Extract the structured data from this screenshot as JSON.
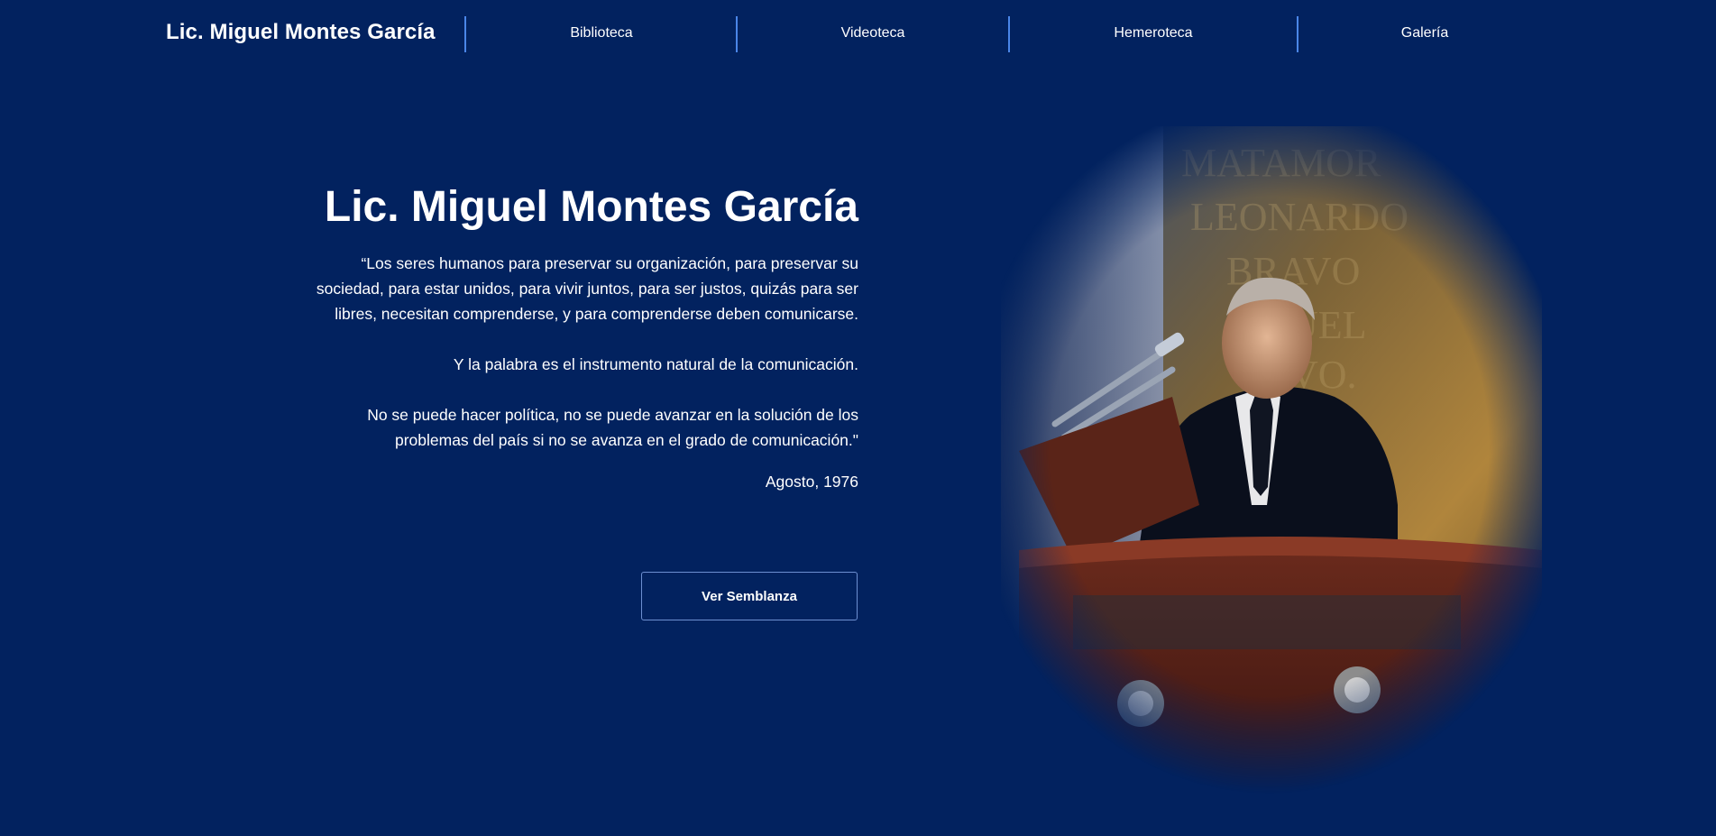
{
  "nav": {
    "brand": "Lic. Miguel Montes García",
    "links": [
      {
        "label": "Biblioteca"
      },
      {
        "label": "Videoteca"
      },
      {
        "label": "Hemeroteca"
      },
      {
        "label": "Galería"
      }
    ]
  },
  "hero": {
    "title": "Lic. Miguel Montes García",
    "quote": {
      "paragraph_1": "“Los seres humanos para preservar su organización, para preservar su sociedad, para estar unidos, para vivir juntos, para ser justos, quizás para ser libres, necesitan comprenderse, y para comprenderse deben comunicarse.",
      "paragraph_2": "Y la palabra es el instrumento natural de la comunicación.",
      "paragraph_3": "No se puede hacer política, no se puede avanzar en la solución de los problemas del país si no se avanza en el grado de comunicación.\"",
      "date": "Agosto, 1976"
    },
    "button_label": "Ver Semblanza"
  },
  "colors": {
    "background": "#02225f",
    "separator": "#4a86e8",
    "button_border": "#6d8fd1"
  }
}
